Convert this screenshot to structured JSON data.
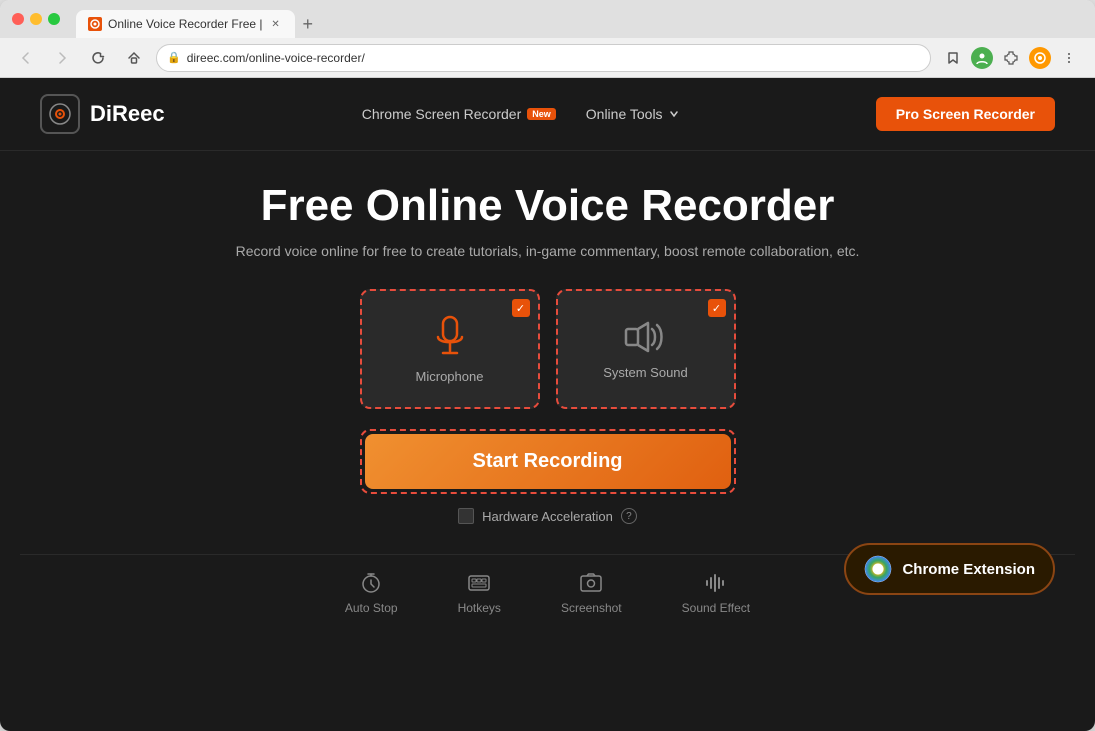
{
  "browser": {
    "tab_title": "Online Voice Recorder Free |",
    "tab_favicon": "🔴",
    "new_tab_label": "+",
    "address_url": "direec.com/online-voice-recorder/",
    "nav_back": "←",
    "nav_forward": "→",
    "nav_reload": "↺",
    "nav_home": "⌂"
  },
  "header": {
    "logo_text": "DiReec",
    "nav_items": [
      {
        "label": "Chrome Screen Recorder",
        "badge": "New"
      },
      {
        "label": "Online Tools",
        "has_dropdown": true
      }
    ],
    "pro_button": "Pro Screen Recorder"
  },
  "hero": {
    "title": "Free Online Voice Recorder",
    "subtitle": "Record voice online for free to create tutorials, in-game commentary, boost remote collaboration, etc."
  },
  "options": [
    {
      "id": "microphone",
      "label": "Microphone",
      "checked": true
    },
    {
      "id": "system-sound",
      "label": "System Sound",
      "checked": true
    }
  ],
  "start_recording_btn": "Start Recording",
  "hardware": {
    "label": "Hardware Acceleration",
    "checked": false,
    "help": "?"
  },
  "chrome_extension": {
    "label": "Chrome Extension"
  },
  "features": [
    {
      "id": "auto-stop",
      "label": "Auto Stop",
      "icon": "⏰"
    },
    {
      "id": "hotkeys",
      "label": "Hotkeys",
      "icon": "⌨"
    },
    {
      "id": "screenshot",
      "label": "Screenshot",
      "icon": "📷"
    },
    {
      "id": "sound-effect",
      "label": "Sound Effect",
      "icon": "🎵"
    }
  ],
  "colors": {
    "accent": "#e8520a",
    "bg_dark": "#1a1a1a",
    "card_bg": "#2a2a2a",
    "dashed_border": "#e74c3c"
  }
}
